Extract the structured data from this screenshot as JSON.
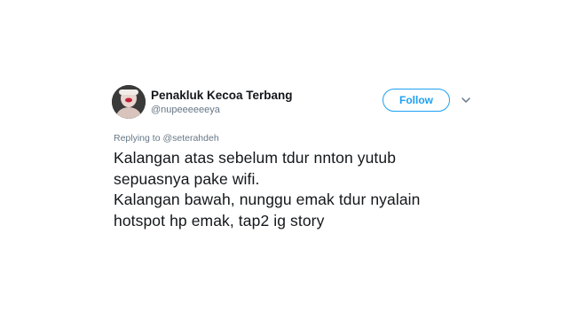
{
  "author": {
    "display_name": "Penakluk Kecoa Terbang",
    "handle": "@nupeeeeeeya",
    "avatar_icon": "user-avatar-photo"
  },
  "actions": {
    "follow_label": "Follow",
    "more_icon": "chevron-down-icon"
  },
  "reply": {
    "prefix": "Replying to",
    "mention": "@seterahdeh"
  },
  "tweet": {
    "lines": [
      "Kalangan atas sebelum tdur nnton yutub",
      "sepuasnya pake wifi.",
      "Kalangan bawah, nunggu emak tdur nyalain",
      "hotspot hp emak, tap2 ig story"
    ]
  },
  "colors": {
    "accent": "#1da1f2",
    "text_primary": "#14171a",
    "text_secondary": "#657786",
    "background": "#ffffff"
  }
}
